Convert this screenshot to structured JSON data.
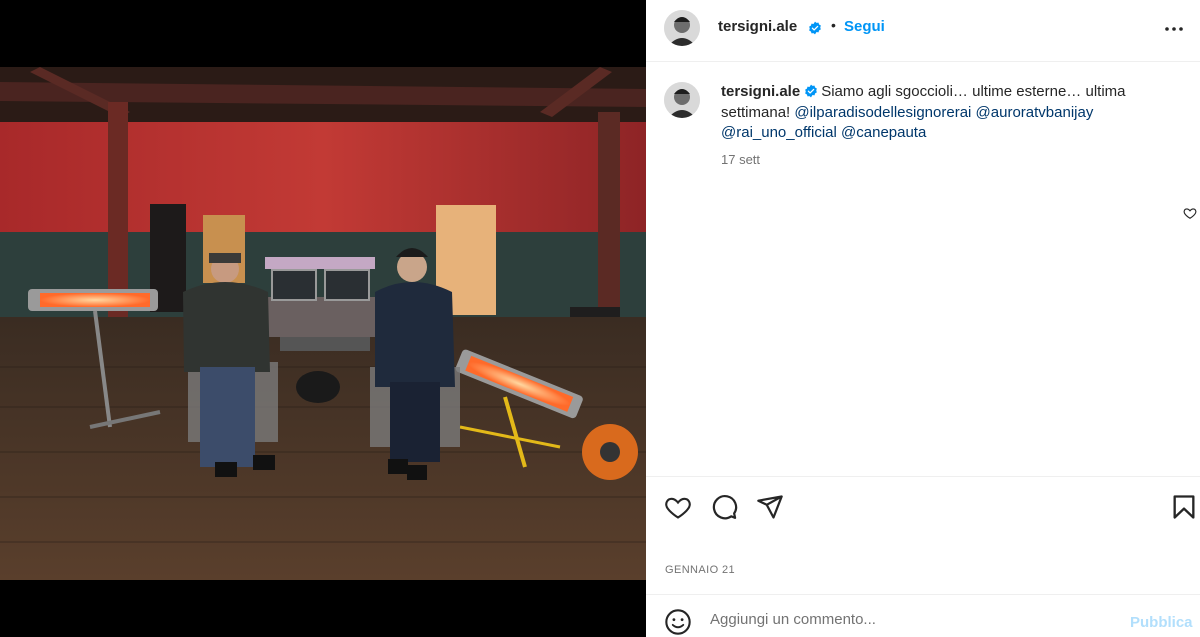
{
  "post": {
    "username": "tersigni.ale",
    "follow_label": "Segui",
    "separator": "•",
    "caption_text": "Siamo agli sgoccioli… ultime esterne… ultima settimana!",
    "mentions": [
      "@ilparadisodellesignorerai",
      "@auroratvbanijay",
      "@rai_uno_official",
      "@canepauta"
    ],
    "caption_time": "17 sett",
    "post_date": "GENNAIO 21"
  },
  "comment": {
    "placeholder": "Aggiungi un commento...",
    "publish_label": "Pubblica"
  },
  "icons": {
    "verified": "verified-badge-icon",
    "more": "more-options-icon",
    "like": "heart-icon",
    "comment": "comment-icon",
    "share": "share-icon",
    "save": "bookmark-icon",
    "emoji": "emoji-icon"
  },
  "colors": {
    "accent": "#0095f6",
    "mention": "#00376b",
    "publish_disabled": "#b2dffc",
    "muted": "#737373"
  }
}
